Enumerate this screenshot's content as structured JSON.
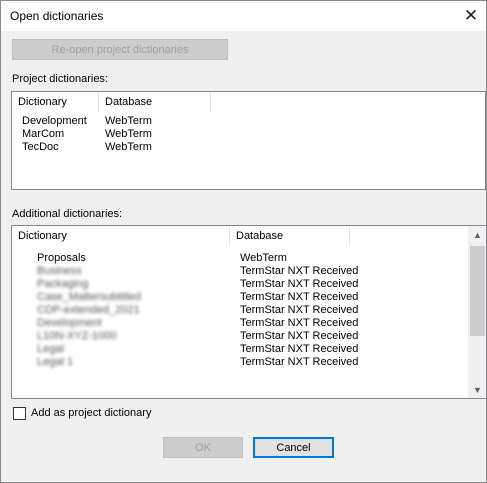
{
  "dialog": {
    "title": "Open dictionaries"
  },
  "reopen_button": "Re-open project dictionaries",
  "project": {
    "label": "Project dictionaries:",
    "columns": [
      "Dictionary",
      "Database"
    ],
    "rows": [
      {
        "dictionary": "Development",
        "database": "WebTerm"
      },
      {
        "dictionary": "MarCom",
        "database": "WebTerm"
      },
      {
        "dictionary": "TecDoc",
        "database": "WebTerm"
      }
    ]
  },
  "additional": {
    "label": "Additional dictionaries:",
    "columns": [
      "Dictionary",
      "Database"
    ],
    "rows": [
      {
        "dictionary": "Proposals",
        "database": "WebTerm"
      },
      {
        "dictionary": "Business",
        "database": "TermStar NXT Received"
      },
      {
        "dictionary": "Packaging",
        "database": "TermStar NXT Received"
      },
      {
        "dictionary": "Case_Mattersubtitled",
        "database": "TermStar NXT Received"
      },
      {
        "dictionary": "CDP-extended_2021",
        "database": "TermStar NXT Received"
      },
      {
        "dictionary": "Development",
        "database": "TermStar NXT Received"
      },
      {
        "dictionary": "L10N-XYZ-1000",
        "database": "TermStar NXT Received"
      },
      {
        "dictionary": "Legal",
        "database": "TermStar NXT Received"
      },
      {
        "dictionary": "Legal 1",
        "database": "TermStar NXT Received"
      }
    ]
  },
  "add_as_project_label": "Add as project dictionary",
  "ok_label": "OK",
  "cancel_label": "Cancel"
}
